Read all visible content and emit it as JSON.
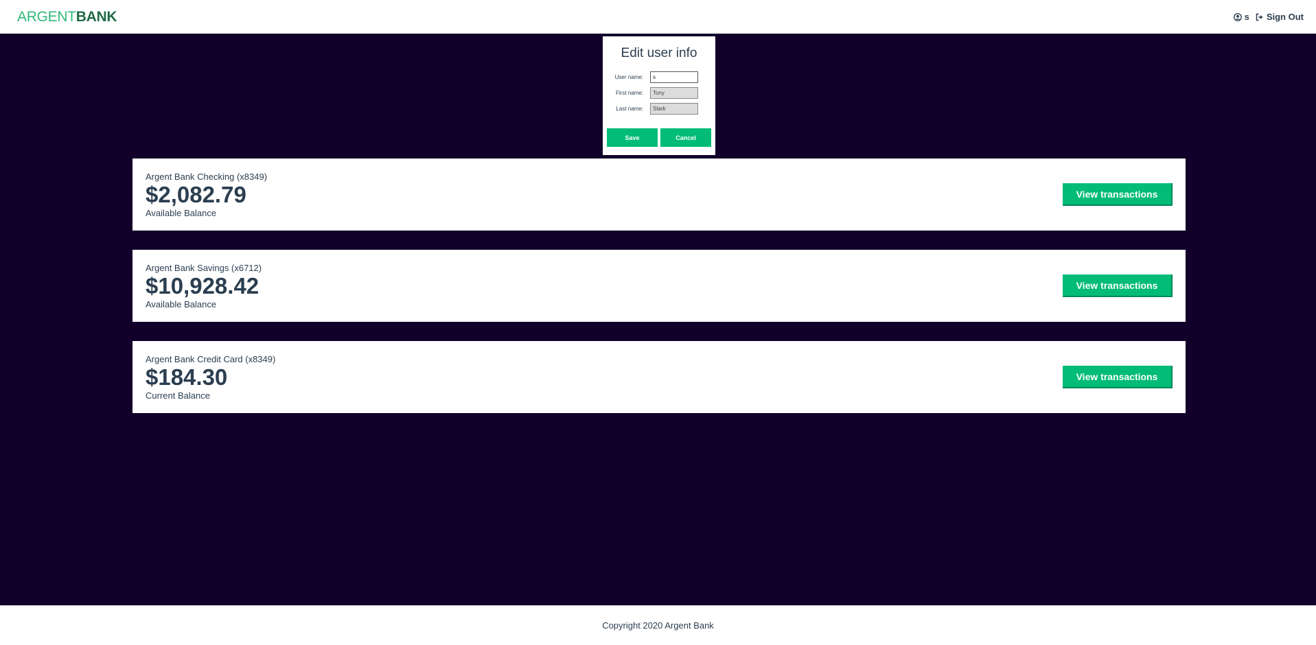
{
  "header": {
    "logo_part1": "ARGENT",
    "logo_part2": "BANK",
    "user_name": "s",
    "sign_out_label": "Sign Out"
  },
  "edit_form": {
    "title": "Edit user info",
    "username_label": "User name:",
    "username_value": "s",
    "firstname_label": "First name:",
    "firstname_value": "Tony",
    "lastname_label": "Last name:",
    "lastname_value": "Stark",
    "save_label": "Save",
    "cancel_label": "Cancel"
  },
  "accounts": [
    {
      "title": "Argent Bank Checking (x8349)",
      "amount": "$2,082.79",
      "description": "Available Balance",
      "button_label": "View transactions"
    },
    {
      "title": "Argent Bank Savings (x6712)",
      "amount": "$10,928.42",
      "description": "Available Balance",
      "button_label": "View transactions"
    },
    {
      "title": "Argent Bank Credit Card (x8349)",
      "amount": "$184.30",
      "description": "Current Balance",
      "button_label": "View transactions"
    }
  ],
  "footer": {
    "copyright": "Copyright 2020 Argent Bank"
  },
  "colors": {
    "brand_green": "#00bc77",
    "background_dark": "#12002b",
    "text_dark": "#2c3e50"
  }
}
